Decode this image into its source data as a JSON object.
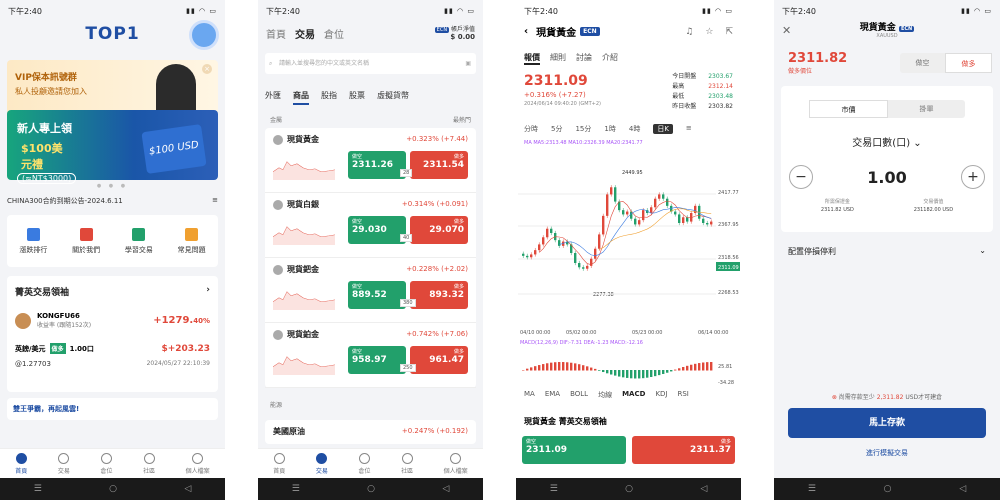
{
  "status": {
    "time": "下午2:40",
    "icons": "▮▮ ◠ ▭"
  },
  "nav": {
    "square": "☰",
    "circle": "○",
    "back": "◁"
  },
  "home": {
    "logo": "TOP1",
    "vip_title": "VIP保本訊號群",
    "vip_sub": "私人投顧邀請您加入",
    "promo_a": "新人專上領",
    "promo_b": "$100美元禮",
    "promo_c": "(≈NT$3000)",
    "promo_card": "$100 USD",
    "notice": "CHINA300合約到期公告-2024.6.11",
    "quick": [
      "漲跌排行",
      "關於我們",
      "學習交易",
      "常見問題"
    ],
    "elite_title": "菁英交易領袖",
    "trader_name": "KONGFU66",
    "trader_sub": "收益率 (跟隨152次)",
    "trader_pct": "+1279.",
    "trader_pct_dec": "40%",
    "deal_pair": "英鎊/美元",
    "deal_side": "做多",
    "deal_lot": "1.00口",
    "deal_pl": "$+203.23",
    "deal_price": "@1.27703",
    "deal_time": "2024/05/27 22:10:39",
    "ad": "雙王爭霸，再起風雲!",
    "tabs": [
      "首頁",
      "交易",
      "倉位",
      "社區",
      "個人檔案"
    ]
  },
  "market": {
    "tabs": [
      "首頁",
      "交易",
      "倉位",
      "社區",
      "個人檔案"
    ],
    "ecn": "ECN",
    "acct": "帳戶淨值",
    "value": "$ 0.00",
    "search_placeholder": "請輸入並搜尋您的中文或英文名稱",
    "cats": [
      "外匯",
      "商品",
      "股指",
      "股票",
      "虛擬貨幣"
    ],
    "section": "金屬",
    "sort": "最熱門",
    "section2": "能源",
    "sell": "做空",
    "buy": "做多",
    "rows": [
      {
        "name": "現貨黃金",
        "chg": "+0.323% (+7.44)",
        "sell": "2311.26",
        "spread": "28",
        "buy": "2311.54"
      },
      {
        "name": "現貨白銀",
        "chg": "+0.314% (+0.091)",
        "sell": "29.030",
        "spread": "40",
        "buy": "29.070"
      },
      {
        "name": "現貨鈀金",
        "chg": "+0.228% (+2.02)",
        "sell": "889.52",
        "spread": "380",
        "buy": "893.32"
      },
      {
        "name": "現貨鉑金",
        "chg": "+0.742% (+7.06)",
        "sell": "958.97",
        "spread": "250",
        "buy": "961.47"
      }
    ],
    "oil": {
      "name": "美國原油",
      "chg": "+0.247% (+0.192)"
    }
  },
  "detail": {
    "title": "現貨黃金",
    "ecn": "ECN",
    "tabs": [
      "報價",
      "細則",
      "討論",
      "介紹"
    ],
    "price": "2311.09",
    "chg": "+0.316% (+7.27)",
    "dt": "2024/06/14 09:40:20 (GMT+2)",
    "stats": [
      [
        "今日開盤",
        "2303.67"
      ],
      [
        "最高",
        "2312.14"
      ],
      [
        "最低",
        "2303.48"
      ],
      [
        "昨日收盤",
        "2303.82"
      ]
    ],
    "tf": [
      "分時",
      "5分",
      "15分",
      "1時",
      "4時",
      "日K"
    ],
    "ma": "MA  MA5:2313.48  MA10:2326.39  MA20:2341.77",
    "y_labels": [
      "2417.77",
      "2367.95",
      "2318.56",
      "2311.09",
      "2268.53"
    ],
    "hi_label": "2449.95",
    "lo_label": "2277.38",
    "x_labels": [
      "04/10 00:00",
      "05/02 00:00",
      "05/23 00:00",
      "06/14 00:00"
    ],
    "macd_label": "MACD(12,26,9)  DIF:-7.31  DEA:-1.23  MACD:-12.16",
    "macd_y": [
      "25.81",
      "-34.28"
    ],
    "ind": [
      "MA",
      "EMA",
      "BOLL",
      "均線",
      "MACD",
      "KDJ",
      "RSI"
    ],
    "lead": "現貨黃金 菁英交易領袖",
    "sell": "做空",
    "sell_p": "2311.09",
    "buy": "做多",
    "buy_p": "2311.37"
  },
  "order": {
    "title": "現貨黃金",
    "ecn": "ECN",
    "sub": "XAUUSD",
    "price": "2311.82",
    "price_sub": "做多價位",
    "sides": [
      "做空",
      "做多"
    ],
    "types": [
      "市價",
      "掛單"
    ],
    "lot_label": "交易口數(口)",
    "qty": "1.00",
    "minus": "−",
    "plus": "+",
    "m1_label": "所需保證金",
    "m1": "2311.82 USD",
    "m2_label": "交易價值",
    "m2": "231182.00 USD",
    "sltp": "配置停損停利",
    "warn_a": "尚需存款至少",
    "warn_b": "2,311.82",
    "warn_c": "USD才可建倉",
    "deposit": "馬上存款",
    "demo": "進行模擬交易"
  },
  "chart_data": {
    "type": "candlestick",
    "x_range": [
      "04/10",
      "06/14"
    ],
    "ylim": [
      2268,
      2450
    ],
    "labels": {
      "high": 2449.95,
      "low": 2277.38,
      "last": 2311.09
    }
  }
}
